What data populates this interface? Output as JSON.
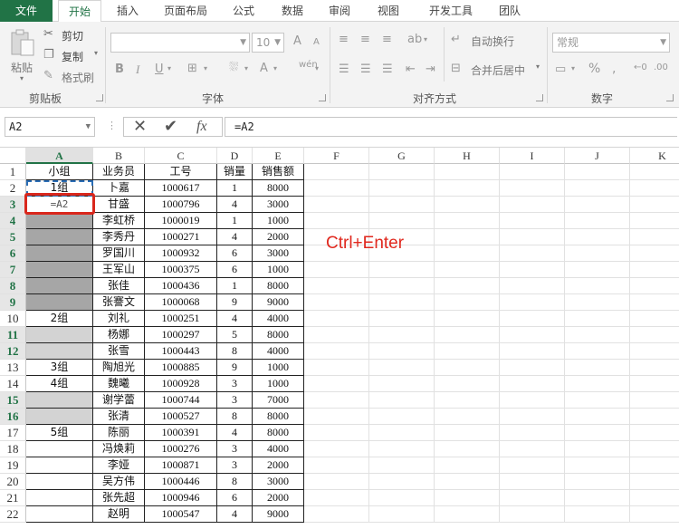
{
  "ribbon_tabs": [
    "文件",
    "开始",
    "插入",
    "页面布局",
    "公式",
    "数据",
    "审阅",
    "视图",
    "开发工具",
    "团队"
  ],
  "clipboard": {
    "paste": "粘贴",
    "cut": "剪切",
    "copy": "复制",
    "format_painter": "格式刷",
    "label": "剪贴板"
  },
  "font": {
    "size": "10",
    "bold": "B",
    "italic": "I",
    "underline": "U",
    "font_color": "A",
    "wen": "wén",
    "grow": "A",
    "shrink": "A",
    "label": "字体"
  },
  "alignment": {
    "wrap": "自动换行",
    "merge": "合并后居中",
    "label": "对齐方式"
  },
  "number": {
    "format": "常规",
    "percent": "%",
    "label": "数字"
  },
  "formula_bar": {
    "name_box": "A2",
    "formula": "=A2",
    "fx": "fx"
  },
  "columns": [
    "A",
    "B",
    "C",
    "D",
    "E",
    "F",
    "G",
    "H",
    "I",
    "J",
    "K"
  ],
  "rows": [
    1,
    2,
    3,
    4,
    5,
    6,
    7,
    8,
    9,
    10,
    11,
    12,
    13,
    14,
    15,
    16,
    17,
    18,
    19,
    20,
    21,
    22
  ],
  "table": {
    "header": [
      "小组",
      "业务员",
      "工号",
      "销量",
      "销售额"
    ],
    "rows": [
      [
        "1组",
        "卜嘉",
        "1000617",
        "1",
        "8000"
      ],
      [
        "=A2",
        "甘盛",
        "1000796",
        "4",
        "3000"
      ],
      [
        "",
        "李虹桥",
        "1000019",
        "1",
        "1000"
      ],
      [
        "",
        "李秀丹",
        "1000271",
        "4",
        "2000"
      ],
      [
        "",
        "罗国川",
        "1000932",
        "6",
        "3000"
      ],
      [
        "",
        "王军山",
        "1000375",
        "6",
        "1000"
      ],
      [
        "",
        "张佳",
        "1000436",
        "1",
        "8000"
      ],
      [
        "",
        "张謇文",
        "1000068",
        "9",
        "9000"
      ],
      [
        "2组",
        "刘礼",
        "1000251",
        "4",
        "4000"
      ],
      [
        "",
        "杨娜",
        "1000297",
        "5",
        "8000"
      ],
      [
        "",
        "张雪",
        "1000443",
        "8",
        "4000"
      ],
      [
        "3组",
        "陶旭光",
        "1000885",
        "9",
        "1000"
      ],
      [
        "4组",
        "魏曦",
        "1000928",
        "3",
        "1000"
      ],
      [
        "",
        "谢学蕾",
        "1000744",
        "3",
        "7000"
      ],
      [
        "",
        "张清",
        "1000527",
        "8",
        "8000"
      ],
      [
        "5组",
        "陈丽",
        "1000391",
        "4",
        "8000"
      ],
      [
        "",
        "冯焕莉",
        "1000276",
        "3",
        "4000"
      ],
      [
        "",
        "李娅",
        "1000871",
        "3",
        "2000"
      ],
      [
        "",
        "吴方伟",
        "1000446",
        "8",
        "3000"
      ],
      [
        "",
        "张先超",
        "1000946",
        "6",
        "2000"
      ],
      [
        "",
        "赵明",
        "1000547",
        "4",
        "9000"
      ]
    ]
  },
  "annotation": "Ctrl+Enter",
  "colors": {
    "accent": "#217346",
    "dark_fill": "#a6a6a6",
    "light_fill": "#d3d3d3",
    "highlight": "#e0281e"
  }
}
